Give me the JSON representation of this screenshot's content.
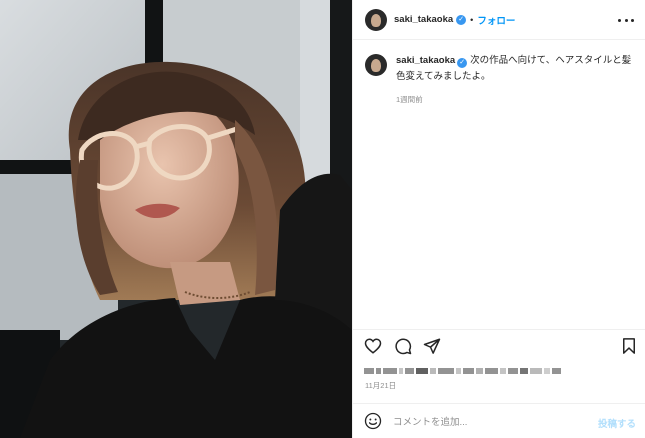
{
  "post": {
    "username": "saki_takaoka",
    "follow_label": "フォロー",
    "dot_separator": "•",
    "verified_mark": "✓",
    "caption_text": "次の作品へ向けて、ヘアスタイルと髪色変えてみましたよ。",
    "time_ago": "1週間前",
    "date": "11月21日",
    "likes_text_obscured": true
  },
  "comment": {
    "placeholder": "コメントを追加...",
    "post_label": "投稿する"
  },
  "icons": {
    "more": "more-options-icon",
    "like": "heart-icon",
    "comment": "comment-bubble-icon",
    "share": "paper-plane-icon",
    "save": "bookmark-icon",
    "emoji": "smiley-icon",
    "verified": "verified-badge-icon"
  },
  "colors": {
    "accent": "#0095f6",
    "verified": "#3897f0",
    "muted": "#8e8e8e",
    "post_disabled": "#b2dffc",
    "border": "#efefef"
  }
}
